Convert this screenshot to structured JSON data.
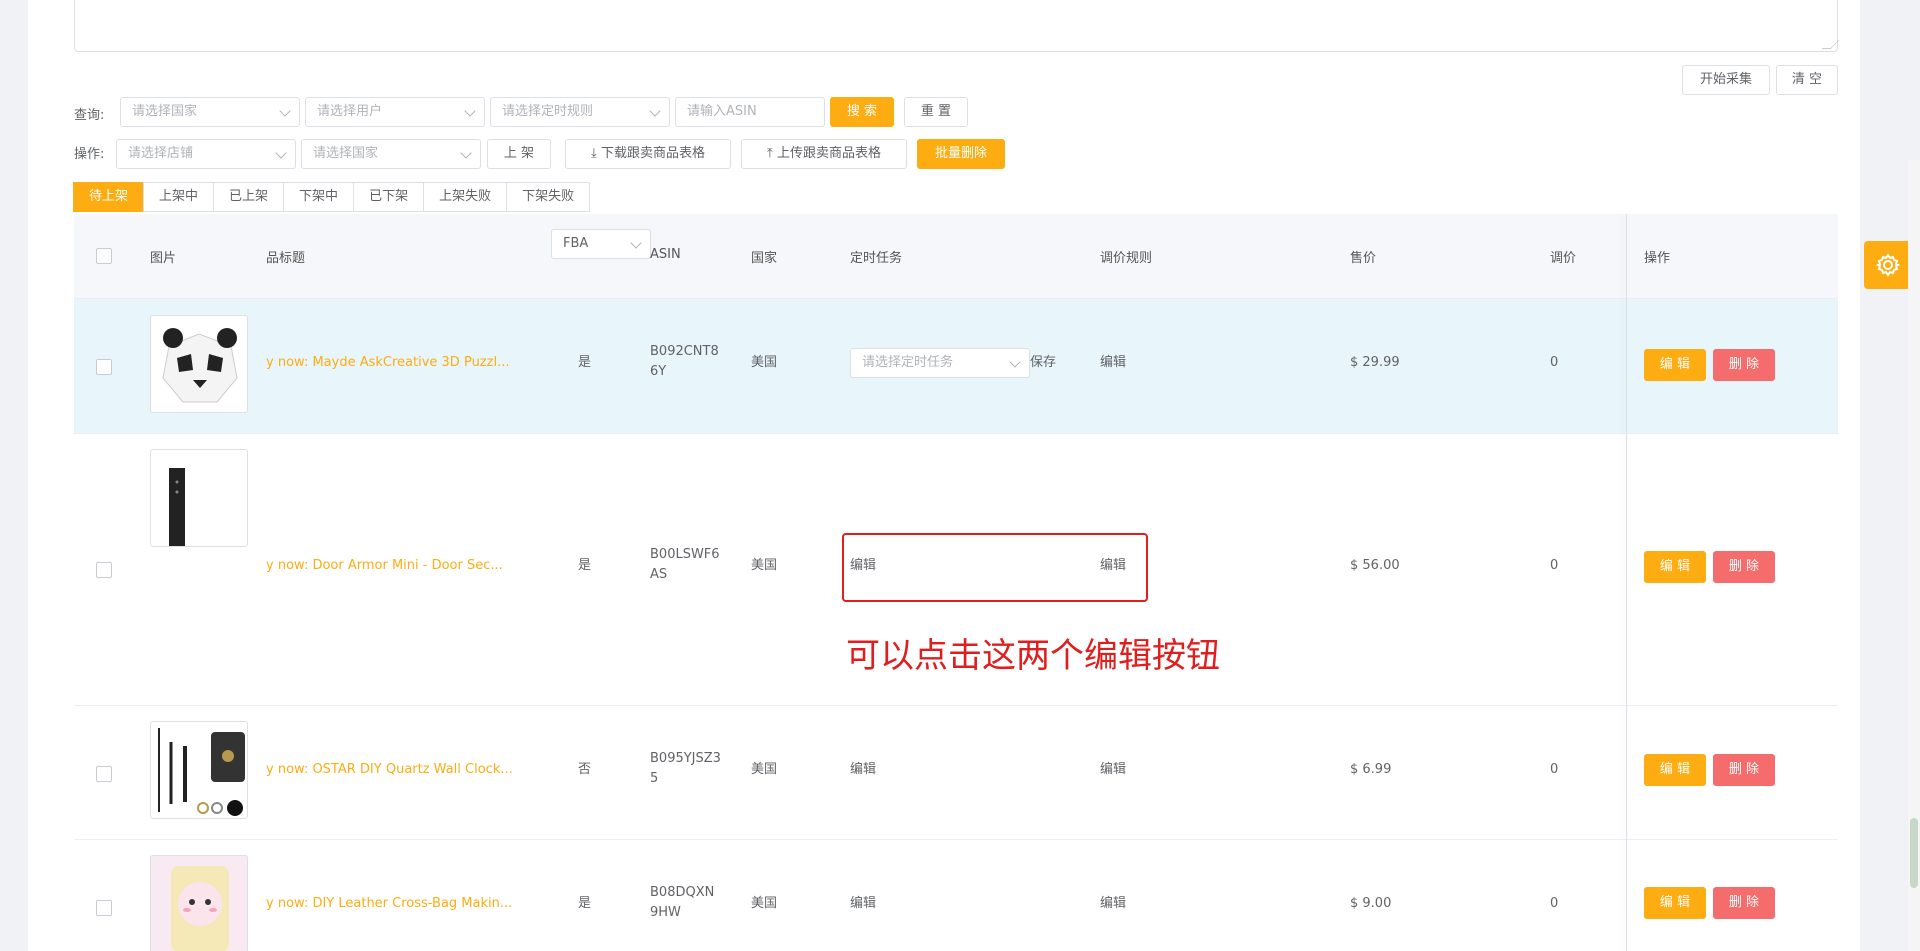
{
  "collect_buttons": {
    "start": "开始采集",
    "clear": "清 空"
  },
  "query": {
    "label": "查询:",
    "country_placeholder": "请选择国家",
    "user_placeholder": "请选择用户",
    "rule_placeholder": "请选择定时规则",
    "asin_placeholder": "请输入ASIN",
    "search": "搜 索",
    "reset": "重 置"
  },
  "operation": {
    "label": "操作:",
    "store_placeholder": "请选择店铺",
    "country_placeholder": "请选择国家",
    "list_btn": "上 架",
    "download_btn": "下载跟卖商品表格",
    "upload_btn": "上传跟卖商品表格",
    "batch_delete": "批量删除"
  },
  "tabs": [
    "待上架",
    "上架中",
    "已上架",
    "下架中",
    "已下架",
    "上架失败",
    "下架失败"
  ],
  "table": {
    "headers": {
      "image": "图片",
      "title": "品标题",
      "fba_filter": "FBA",
      "asin": "ASIN",
      "country": "国家",
      "timed_task": "定时任务",
      "pricing_rule": "调价规则",
      "price": "售价",
      "adjust": "调价",
      "actions": "操作"
    },
    "rows": [
      {
        "title": "y now: Mayde AskCreative 3D Puzzl...",
        "fba": "是",
        "asin1": "B092CNT8",
        "asin2": "6Y",
        "country": "美国",
        "task_placeholder": "请选择定时任务",
        "save": "保存",
        "rule": "编辑",
        "price": "$ 29.99",
        "adjust": "0",
        "edit": "编 辑",
        "delete": "删 除",
        "image_icon": "panda-head-icon"
      },
      {
        "title": "y now: Door Armor Mini - Door Sec...",
        "fba": "是",
        "asin1": "B00LSWF6",
        "asin2": "AS",
        "country": "美国",
        "task": "编辑",
        "rule": "编辑",
        "price": "$ 56.00",
        "adjust": "0",
        "edit": "编 辑",
        "delete": "删 除",
        "image_icon": "door-armor-icon"
      },
      {
        "title": "y now: OSTAR DIY Quartz Wall Clock...",
        "fba": "否",
        "asin1": "B095YJSZ3",
        "asin2": "5",
        "country": "美国",
        "task": "编辑",
        "rule": "编辑",
        "price": "$ 6.99",
        "adjust": "0",
        "edit": "编 辑",
        "delete": "删 除",
        "image_icon": "clock-hands-icon"
      },
      {
        "title": "y now: DIY Leather Cross-Bag Makin...",
        "fba": "是",
        "asin1": "B08DQXN",
        "asin2": "9HW",
        "country": "美国",
        "task": "编辑",
        "rule": "编辑",
        "price": "$ 9.00",
        "adjust": "0",
        "edit": "编 辑",
        "delete": "删 除",
        "image_icon": "sheep-bag-icon"
      }
    ]
  },
  "annotation": "可以点击这两个编辑按钮",
  "colors": {
    "accent": "#fdac11",
    "danger": "#f56c6c",
    "annotation": "#e01e1e"
  }
}
